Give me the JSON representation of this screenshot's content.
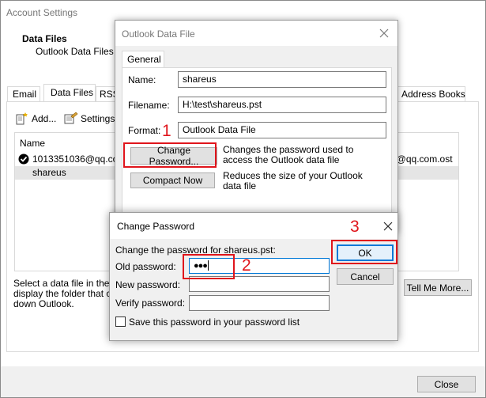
{
  "account_settings": {
    "title": "Account Settings",
    "heading": "Data Files",
    "subheading": "Outlook Data Files",
    "tabs": [
      "Email",
      "Data Files",
      "RSS",
      "Address Books"
    ],
    "toolbar": {
      "add": "Add...",
      "settings": "Settings..."
    },
    "list": {
      "header": "Name",
      "rows": [
        {
          "name": "1013351036@qq.com",
          "location": "6@qq.com.ost"
        },
        {
          "name": "shareus"
        }
      ]
    },
    "info_text": [
      "Select a data file in the l",
      "display the folder that c",
      "down Outlook."
    ],
    "tell_me_more": "Tell Me More...",
    "close": "Close"
  },
  "outlook_data_file": {
    "title": "Outlook Data File",
    "tab": "General",
    "name_label": "Name:",
    "name_value": "shareus",
    "filename_label": "Filename:",
    "filename_value": "H:\\test\\shareus.pst",
    "format_label": "Format:",
    "format_value": "Outlook Data File",
    "change_password_button": "Change Password...",
    "change_password_desc": [
      "Changes the password used to",
      "access the Outlook data file"
    ],
    "compact_now_button": "Compact Now",
    "compact_now_desc": [
      "Reduces the size of your Outlook",
      "data file"
    ]
  },
  "change_password": {
    "title": "Change Password",
    "intro": "Change the password for shareus.pst:",
    "old_label": "Old password:",
    "old_value": "●●●",
    "new_label": "New password:",
    "verify_label": "Verify password:",
    "save_checkbox": "Save this password in your password list",
    "ok": "OK",
    "cancel": "Cancel"
  },
  "annotations": {
    "step1": "1",
    "step2": "2",
    "step3": "3",
    "color": "#e0151c"
  }
}
